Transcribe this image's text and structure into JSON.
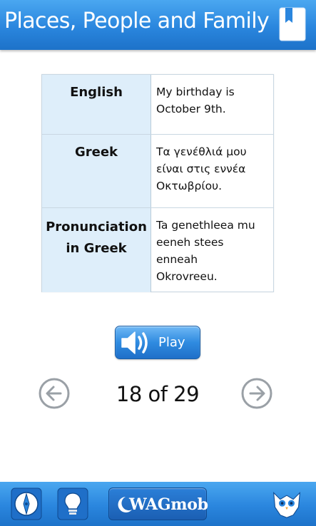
{
  "header": {
    "title": "Places, People and Family",
    "bookmark_icon": "bookmark-icon"
  },
  "card": {
    "rows": [
      {
        "label": "English",
        "value_lines": [
          "My birthday is",
          "October 9th."
        ]
      },
      {
        "label": "Greek",
        "value_lines": [
          "Τα γενέθλιά μου",
          "είναι στις εννέα",
          "Οκτωβρίου."
        ]
      },
      {
        "label_lines": [
          "Pronunciation",
          "in Greek"
        ],
        "value_lines": [
          "Ta genethleea mu",
          "eeneh stees",
          "enneah",
          "Okrovreeu."
        ]
      }
    ]
  },
  "play_button": {
    "label": "Play",
    "icon": "speaker-icon"
  },
  "pager": {
    "counter": "18 of 29",
    "current": 18,
    "total": 29,
    "prev_icon": "arrow-left-circle-icon",
    "next_icon": "arrow-right-circle-icon"
  },
  "footer": {
    "compass_icon": "compass-icon",
    "tips_icon": "lightbulb-icon",
    "brand_label": "WAGmob",
    "mascot_icon": "owl-mascot-icon"
  },
  "colors": {
    "bar_blue": "#2a86de",
    "label_cell_bg": "#deeefa",
    "border": "#c9d7e2"
  }
}
